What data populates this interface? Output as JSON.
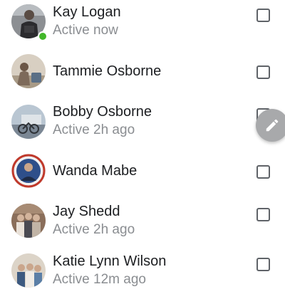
{
  "contacts": [
    {
      "name": "Kay Logan",
      "status": "Active now",
      "online": true
    },
    {
      "name": "Tammie Osborne",
      "status": "",
      "online": false
    },
    {
      "name": "Bobby Osborne",
      "status": "Active 2h ago",
      "online": false
    },
    {
      "name": "Wanda Mabe",
      "status": "",
      "online": false
    },
    {
      "name": "Jay Shedd",
      "status": "Active 2h ago",
      "online": false
    },
    {
      "name": "Katie Lynn Wilson",
      "status": "Active 12m ago",
      "online": false
    }
  ],
  "compose_button": {
    "icon": "pencil-icon"
  },
  "colors": {
    "online": "#42b72a",
    "name_text": "#1c1e21",
    "status_text": "#8a8d91",
    "fab_background": "#a8a9ab"
  }
}
